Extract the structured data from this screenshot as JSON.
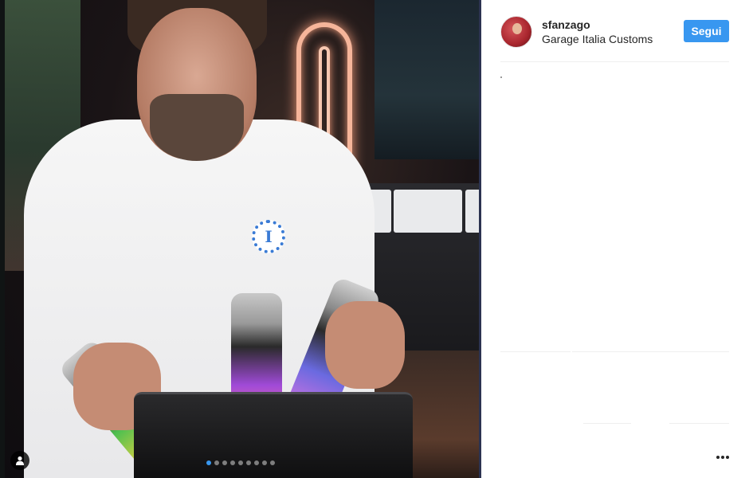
{
  "post": {
    "media": {
      "carousel": {
        "total": 9,
        "active_index": 0
      },
      "icons": {
        "user_tag": "person-icon"
      }
    }
  },
  "header": {
    "username": "sfanzago",
    "location": "Garage Italia Customs",
    "follow_label": "Segui"
  },
  "actions": {
    "more_icon": "more-horizontal-icon"
  },
  "colors": {
    "accent": "#3897f0",
    "text": "#262626",
    "divider": "#efefef"
  }
}
